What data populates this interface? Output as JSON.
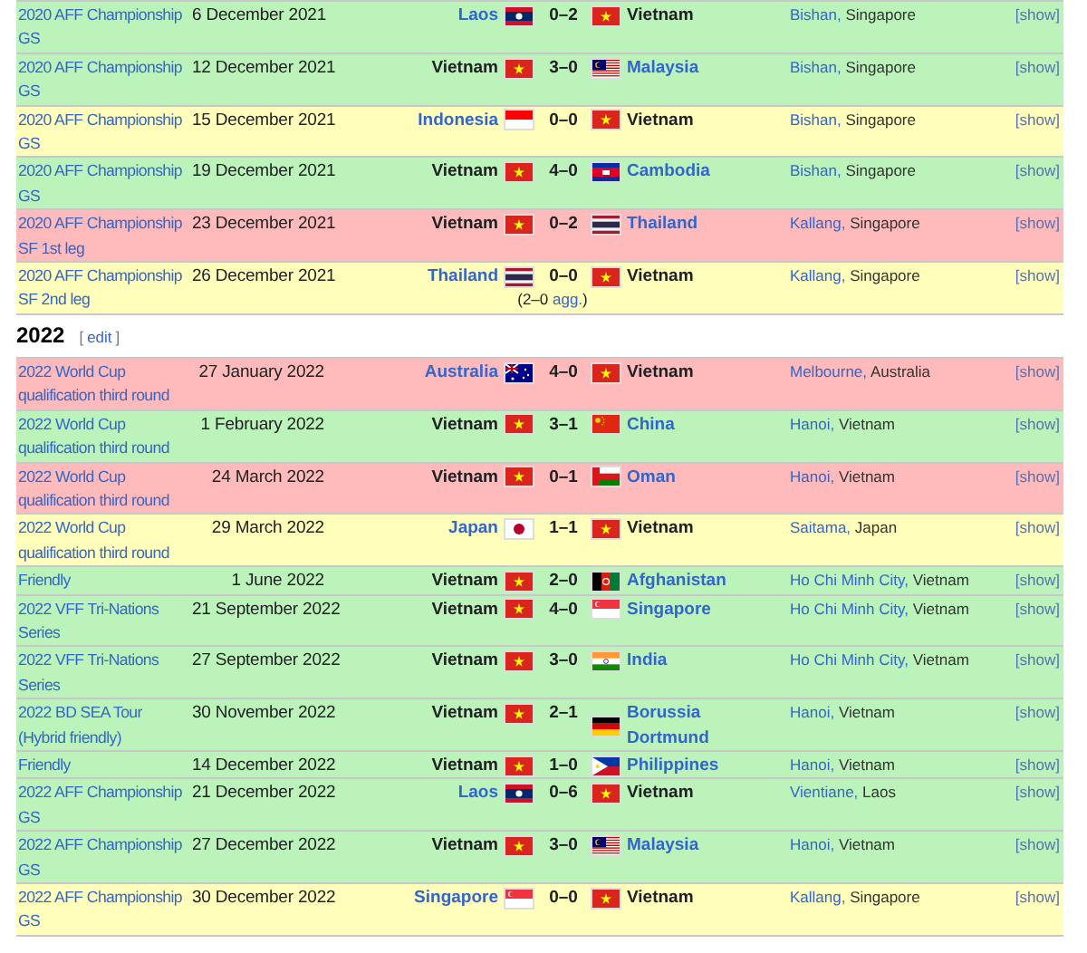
{
  "sections": [
    {
      "matches": [
        {
          "kind": "win",
          "competition": "2020 AFF Championship GS",
          "date": "6 December 2021",
          "home": {
            "name": "Laos",
            "linked": true,
            "flag": {
              "kind": "la"
            }
          },
          "score": "0–2",
          "away": {
            "name": "Vietnam",
            "linked": false,
            "flag": {
              "kind": "vn"
            }
          },
          "venue_city": "Bishan,",
          "venue_country": "Singapore",
          "toggle": "[show]"
        },
        {
          "kind": "win",
          "competition": "2020 AFF Championship GS",
          "date": "12 December 2021",
          "home": {
            "name": "Vietnam",
            "linked": false,
            "flag": {
              "kind": "vn"
            }
          },
          "score": "3–0",
          "away": {
            "name": "Malaysia",
            "linked": true,
            "flag": {
              "kind": "my"
            }
          },
          "venue_city": "Bishan,",
          "venue_country": "Singapore",
          "toggle": "[show]"
        },
        {
          "kind": "draw",
          "competition": "2020 AFF Championship GS",
          "date": "15 December 2021",
          "home": {
            "name": "Indonesia",
            "linked": true,
            "flag": {
              "kind": "id"
            }
          },
          "score": "0–0",
          "away": {
            "name": "Vietnam",
            "linked": false,
            "flag": {
              "kind": "vn"
            }
          },
          "venue_city": "Bishan,",
          "venue_country": "Singapore",
          "toggle": "[show]"
        },
        {
          "kind": "win",
          "competition": "2020 AFF Championship GS",
          "date": "19 December 2021",
          "home": {
            "name": "Vietnam",
            "linked": false,
            "flag": {
              "kind": "vn"
            }
          },
          "score": "4–0",
          "away": {
            "name": "Cambodia",
            "linked": true,
            "flag": {
              "kind": "kh"
            }
          },
          "venue_city": "Bishan,",
          "venue_country": "Singapore",
          "toggle": "[show]"
        },
        {
          "kind": "loss",
          "competition": "2020 AFF Championship SF 1st leg",
          "date": "23 December 2021",
          "home": {
            "name": "Vietnam",
            "linked": false,
            "flag": {
              "kind": "vn"
            }
          },
          "score": "0–2",
          "away": {
            "name": "Thailand",
            "linked": true,
            "flag": {
              "kind": "th"
            }
          },
          "venue_city": "Kallang,",
          "venue_country": "Singapore",
          "toggle": "[show]"
        },
        {
          "kind": "draw",
          "competition": "2020 AFF Championship SF 2nd leg",
          "date": "26 December 2021",
          "home": {
            "name": "Thailand",
            "linked": true,
            "flag": {
              "kind": "th"
            }
          },
          "score": "0–0",
          "aggregate": {
            "open": "(2–0",
            "link": "agg.",
            "close": ")"
          },
          "away": {
            "name": "Vietnam",
            "linked": false,
            "flag": {
              "kind": "vn"
            }
          },
          "venue_city": "Kallang,",
          "venue_country": "Singapore",
          "toggle": "[show]"
        }
      ]
    },
    {
      "heading": "2022",
      "edit": {
        "open": "[",
        "label": "edit",
        "close": "]"
      },
      "matches": [
        {
          "kind": "loss",
          "competition": "2022 World Cup qualification third round",
          "date": "27 January 2022",
          "home": {
            "name": "Australia",
            "linked": true,
            "flag": {
              "kind": "au"
            }
          },
          "score": "4–0",
          "away": {
            "name": "Vietnam",
            "linked": false,
            "flag": {
              "kind": "vn"
            }
          },
          "venue_city": "Melbourne,",
          "venue_country": "Australia",
          "toggle": "[show]"
        },
        {
          "kind": "win",
          "competition": "2022 World Cup qualification third round",
          "date": "1 February 2022",
          "home": {
            "name": "Vietnam",
            "linked": false,
            "flag": {
              "kind": "vn"
            }
          },
          "score": "3–1",
          "away": {
            "name": "China",
            "linked": true,
            "flag": {
              "kind": "cn"
            }
          },
          "venue_city": "Hanoi,",
          "venue_country": "Vietnam",
          "toggle": "[show]"
        },
        {
          "kind": "loss",
          "competition": "2022 World Cup qualification third round",
          "date": "24 March 2022",
          "home": {
            "name": "Vietnam",
            "linked": false,
            "flag": {
              "kind": "vn"
            }
          },
          "score": "0–1",
          "away": {
            "name": "Oman",
            "linked": true,
            "flag": {
              "kind": "om"
            }
          },
          "venue_city": "Hanoi,",
          "venue_country": "Vietnam",
          "toggle": "[show]"
        },
        {
          "kind": "draw",
          "competition": "2022 World Cup qualification third round",
          "date": "29 March 2022",
          "home": {
            "name": "Japan",
            "linked": true,
            "flag": {
              "kind": "jp"
            }
          },
          "score": "1–1",
          "away": {
            "name": "Vietnam",
            "linked": false,
            "flag": {
              "kind": "vn"
            }
          },
          "venue_city": "Saitama,",
          "venue_country": "Japan",
          "toggle": "[show]"
        },
        {
          "kind": "win",
          "competition": "Friendly",
          "date": "1 June 2022",
          "home": {
            "name": "Vietnam",
            "linked": false,
            "flag": {
              "kind": "vn"
            }
          },
          "score": "2–0",
          "away": {
            "name": "Afghanistan",
            "linked": true,
            "flag": {
              "kind": "af"
            }
          },
          "venue_city": "Ho Chi Minh City,",
          "venue_country": "Vietnam",
          "toggle": "[show]"
        },
        {
          "kind": "win",
          "competition": "2022 VFF Tri-Nations Series",
          "date": "21 September 2022",
          "home": {
            "name": "Vietnam",
            "linked": false,
            "flag": {
              "kind": "vn"
            }
          },
          "score": "4–0",
          "away": {
            "name": "Singapore",
            "linked": true,
            "flag": {
              "kind": "sg"
            }
          },
          "venue_city": "Ho Chi Minh City,",
          "venue_country": "Vietnam",
          "toggle": "[show]"
        },
        {
          "kind": "win",
          "competition": "2022 VFF Tri-Nations Series",
          "date": "27 September 2022",
          "home": {
            "name": "Vietnam",
            "linked": false,
            "flag": {
              "kind": "vn"
            }
          },
          "score": "3–0",
          "away": {
            "name": "India",
            "linked": true,
            "flag": {
              "kind": "in"
            }
          },
          "venue_city": "Ho Chi Minh City,",
          "venue_country": "Vietnam",
          "toggle": "[show]"
        },
        {
          "kind": "win",
          "competition": "2022 BD SEA Tour (Hybrid friendly)",
          "date": "30 November 2022",
          "home": {
            "name": "Vietnam",
            "linked": false,
            "flag": {
              "kind": "vn"
            }
          },
          "score": "2–1",
          "away": {
            "name": "Borussia Dortmund",
            "linked": true,
            "flag": {
              "kind": "de"
            }
          },
          "venue_city": "Hanoi,",
          "venue_country": "Vietnam",
          "toggle": "[show]"
        },
        {
          "kind": "win",
          "competition": "Friendly",
          "date": "14 December 2022",
          "home": {
            "name": "Vietnam",
            "linked": false,
            "flag": {
              "kind": "vn"
            }
          },
          "score": "1–0",
          "away": {
            "name": "Philippines",
            "linked": true,
            "flag": {
              "kind": "ph"
            }
          },
          "venue_city": "Hanoi,",
          "venue_country": "Vietnam",
          "toggle": "[show]"
        },
        {
          "kind": "win",
          "competition": "2022 AFF Championship GS",
          "date": "21 December 2022",
          "home": {
            "name": "Laos",
            "linked": true,
            "flag": {
              "kind": "la"
            }
          },
          "score": "0–6",
          "away": {
            "name": "Vietnam",
            "linked": false,
            "flag": {
              "kind": "vn"
            }
          },
          "venue_city": "Vientiane,",
          "venue_country": "Laos",
          "toggle": "[show]"
        },
        {
          "kind": "win",
          "competition": "2022 AFF Championship GS",
          "date": "27 December 2022",
          "home": {
            "name": "Vietnam",
            "linked": false,
            "flag": {
              "kind": "vn"
            }
          },
          "score": "3–0",
          "away": {
            "name": "Malaysia",
            "linked": true,
            "flag": {
              "kind": "my"
            }
          },
          "venue_city": "Hanoi,",
          "venue_country": "Vietnam",
          "toggle": "[show]"
        },
        {
          "kind": "draw",
          "competition": "2022 AFF Championship GS",
          "date": "30 December 2022",
          "home": {
            "name": "Singapore",
            "linked": true,
            "flag": {
              "kind": "sg"
            }
          },
          "score": "0–0",
          "away": {
            "name": "Vietnam",
            "linked": false,
            "flag": {
              "kind": "vn"
            }
          },
          "venue_city": "Kallang,",
          "venue_country": "Singapore",
          "toggle": "[show]"
        }
      ]
    }
  ]
}
